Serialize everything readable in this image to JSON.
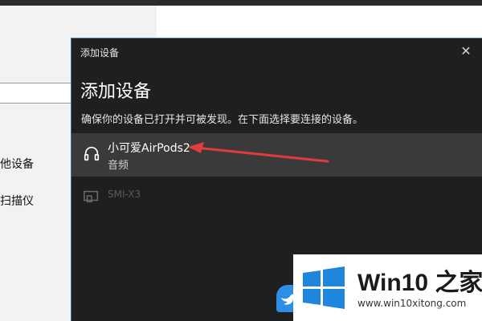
{
  "background": {
    "items": [
      "他设备",
      "扫描仪"
    ]
  },
  "dialog": {
    "window_title": "添加设备",
    "close_glyph": "✕",
    "heading": "添加设备",
    "subtitle": "确保你的设备已打开并可被发现。在下面选择要连接的设备。",
    "devices": [
      {
        "name": "小可爱AirPods2",
        "type": "音频",
        "icon": "headphones-icon"
      },
      {
        "name": "SMI-X3",
        "type": "",
        "icon": "display-icon"
      }
    ]
  },
  "watermark": {
    "brand_latin": "Win10",
    "brand_zh": "之家",
    "url": "www.win10xitong.com"
  },
  "colors": {
    "dialog_bg": "#1f1f1f",
    "selected_row": "#3a3a3a",
    "arrow": "#e03c3c",
    "logo_blue": "#1e86dc"
  }
}
